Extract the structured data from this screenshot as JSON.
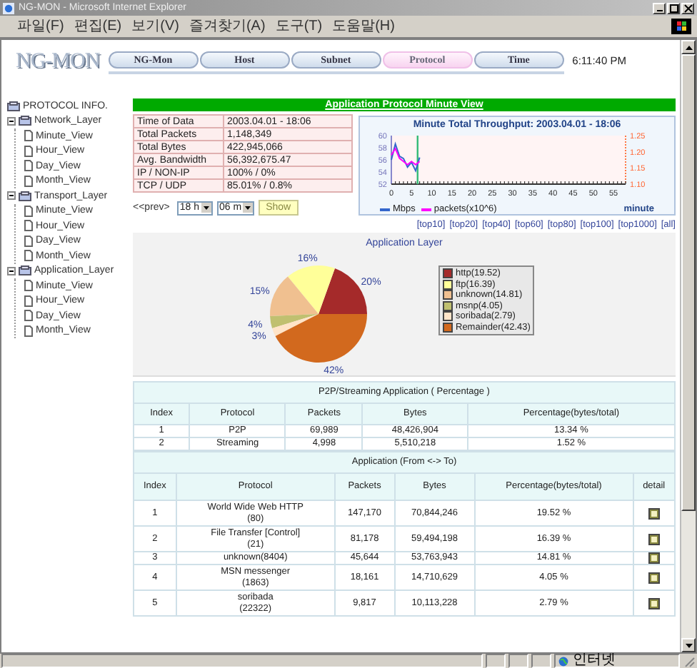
{
  "window": {
    "title": "NG-MON - Microsoft Internet Explorer"
  },
  "menu": [
    "파일(F)",
    "편집(E)",
    "보기(V)",
    "즐겨찾기(A)",
    "도구(T)",
    "도움말(H)"
  ],
  "header": {
    "logo": "NG-MON",
    "time": "6:11:40 PM"
  },
  "nav": [
    {
      "label": "NG-Mon",
      "selected": false
    },
    {
      "label": "Host",
      "selected": false
    },
    {
      "label": "Subnet",
      "selected": false
    },
    {
      "label": "Protocol",
      "selected": true
    },
    {
      "label": "Time",
      "selected": false
    }
  ],
  "sidebar": {
    "title": "PROTOCOL INFO.",
    "items": [
      {
        "label": "Network_Layer",
        "expanded": true,
        "children": [
          {
            "label": "Minute_View"
          },
          {
            "label": "Hour_View"
          },
          {
            "label": "Day_View"
          },
          {
            "label": "Month_View"
          }
        ]
      },
      {
        "label": "Transport_Layer",
        "expanded": true,
        "children": [
          {
            "label": "Minute_View"
          },
          {
            "label": "Hour_View"
          },
          {
            "label": "Day_View"
          },
          {
            "label": "Month_View"
          }
        ]
      },
      {
        "label": "Application_Layer",
        "expanded": true,
        "children": [
          {
            "label": "Minute_View"
          },
          {
            "label": "Hour_View"
          },
          {
            "label": "Day_View"
          },
          {
            "label": "Month_View"
          }
        ]
      }
    ]
  },
  "summary": {
    "title": "Application Protocol Minute View",
    "rows": [
      {
        "label": "Time of Data",
        "value": "2003.04.01 - 18:06"
      },
      {
        "label": "Total Packets",
        "value": "1,148,349"
      },
      {
        "label": "Total Bytes",
        "value": "422,945,066"
      },
      {
        "label": "Avg. Bandwidth",
        "value": "56,392,675.47"
      },
      {
        "label": "IP / NON-IP",
        "value": "100% / 0%"
      },
      {
        "label": "TCP / UDP",
        "value": "85.01% / 0.8%"
      }
    ]
  },
  "controls": {
    "prev": "<<prev>",
    "hour": "18 h",
    "minute": "06 m",
    "show": "Show"
  },
  "throughput": {
    "chart_data": {
      "type": "line",
      "title": "Minute Total Throughput: 2003.04.01 - 18:06",
      "xlabel": "minute",
      "x": [
        0,
        1,
        2,
        3,
        4,
        5,
        6,
        7
      ],
      "series": [
        {
          "name": "Mbps",
          "color": "#3366cc",
          "values": [
            56,
            58.6,
            56.6,
            56.2,
            54.8,
            55.6,
            54.2,
            56.4
          ]
        },
        {
          "name": "packets(x10^6)",
          "color": "#ff00ff",
          "axis": "y2",
          "values": [
            1.19,
            1.21,
            1.18,
            1.17,
            1.16,
            1.17,
            1.16,
            1.17
          ]
        }
      ],
      "xlim": [
        0,
        58
      ],
      "ylim": [
        52,
        60
      ],
      "y2lim": [
        1.1,
        1.25
      ],
      "xticks": [
        0,
        5,
        10,
        15,
        20,
        25,
        30,
        35,
        40,
        45,
        50,
        55
      ],
      "yticks": [
        52,
        54,
        56,
        58,
        60
      ],
      "y2ticks": [
        {
          "value": 1.1,
          "label": "1.10"
        },
        {
          "value": 1.15,
          "label": "1.15"
        },
        {
          "value": 1.2,
          "label": "1.20"
        },
        {
          "value": 1.25,
          "label": "1.25"
        }
      ],
      "ref_lines": [
        {
          "axis": "x",
          "value": 6.5
        }
      ]
    }
  },
  "top_links": [
    "[top10]",
    "[top20]",
    "[top40]",
    "[top60]",
    "[top80]",
    "[top100]",
    "[top1000]",
    "[all]"
  ],
  "pie": {
    "chart_data": {
      "type": "pie",
      "title": "Application Layer",
      "categories": [
        "http(19.52)",
        "ftp(16.39)",
        "unknown(14.81)",
        "msnp(4.05)",
        "soribada(2.79)",
        "Remainder(42.43)"
      ],
      "values": [
        19.52,
        16.39,
        14.81,
        4.05,
        2.79,
        42.43
      ],
      "colors": [
        "#a52a2a",
        "#ffff99",
        "#f0c090",
        "#c0c070",
        "#ffe4c8",
        "#d2691e"
      ],
      "value_labels": [
        "20%",
        "16%",
        "15%",
        "4%",
        "3%",
        "42%"
      ]
    }
  },
  "p2p_table": {
    "title": "P2P/Streaming Application ( Percentage )",
    "columns": [
      "Index",
      "Protocol",
      "Packets",
      "Bytes",
      "Percentage(bytes/total)"
    ],
    "rows": [
      {
        "index": "1",
        "protocol": "P2P",
        "packets": "69,989",
        "bytes": "48,426,904",
        "percentage": "13.34 %"
      },
      {
        "index": "2",
        "protocol": "Streaming",
        "packets": "4,998",
        "bytes": "5,510,218",
        "percentage": "1.52 %"
      }
    ]
  },
  "app_table": {
    "title": "Application (From <-> To)",
    "columns": [
      "Index",
      "Protocol",
      "Packets",
      "Bytes",
      "Percentage(bytes/total)",
      "detail"
    ],
    "rows": [
      {
        "index": "1",
        "protocol": "World Wide Web HTTP",
        "port": "(80)",
        "packets": "147,170",
        "bytes": "70,844,246",
        "percentage": "19.52 %"
      },
      {
        "index": "2",
        "protocol": "File Transfer [Control]",
        "port": "(21)",
        "packets": "81,178",
        "bytes": "59,494,198",
        "percentage": "16.39 %"
      },
      {
        "index": "3",
        "protocol": "unknown(8404)",
        "packets": "45,644",
        "bytes": "53,763,943",
        "percentage": "14.81 %"
      },
      {
        "index": "4",
        "protocol": "MSN messenger",
        "port": "(1863)",
        "packets": "18,161",
        "bytes": "14,710,629",
        "percentage": "4.05 %"
      },
      {
        "index": "5",
        "protocol": "soribada",
        "port": "(22322)",
        "packets": "9,817",
        "bytes": "10,113,228",
        "percentage": "2.79 %"
      }
    ]
  },
  "status_bar": {
    "zone": "인터넷"
  }
}
